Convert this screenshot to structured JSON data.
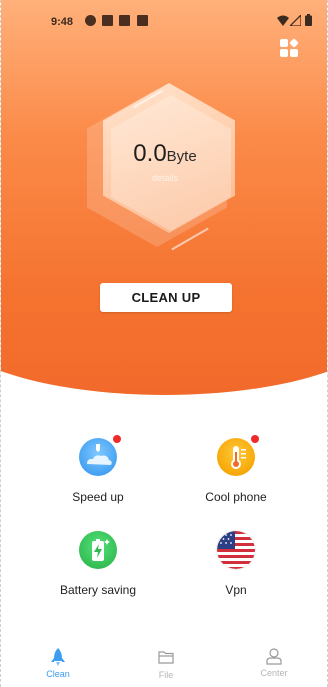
{
  "status_bar": {
    "time": "9:48"
  },
  "storage": {
    "value": "0.0",
    "unit": "Byte",
    "details_label": "details"
  },
  "actions": {
    "clean_up": "CLEAN UP"
  },
  "features": [
    {
      "label": "Speed up",
      "icon": "rocket-cloud-icon",
      "badge": true
    },
    {
      "label": "Cool phone",
      "icon": "thermometer-icon",
      "badge": true
    },
    {
      "label": "Battery saving",
      "icon": "battery-icon",
      "badge": false
    },
    {
      "label": "Vpn",
      "icon": "us-flag-icon",
      "badge": false
    }
  ],
  "nav": [
    {
      "label": "Clean",
      "icon": "rocket-icon",
      "active": true
    },
    {
      "label": "File",
      "icon": "folder-icon",
      "active": false
    },
    {
      "label": "Center",
      "icon": "person-icon",
      "active": false
    }
  ],
  "colors": {
    "accent": "#f5722f",
    "active_nav": "#3d9df0",
    "badge": "#ee2a2a"
  }
}
